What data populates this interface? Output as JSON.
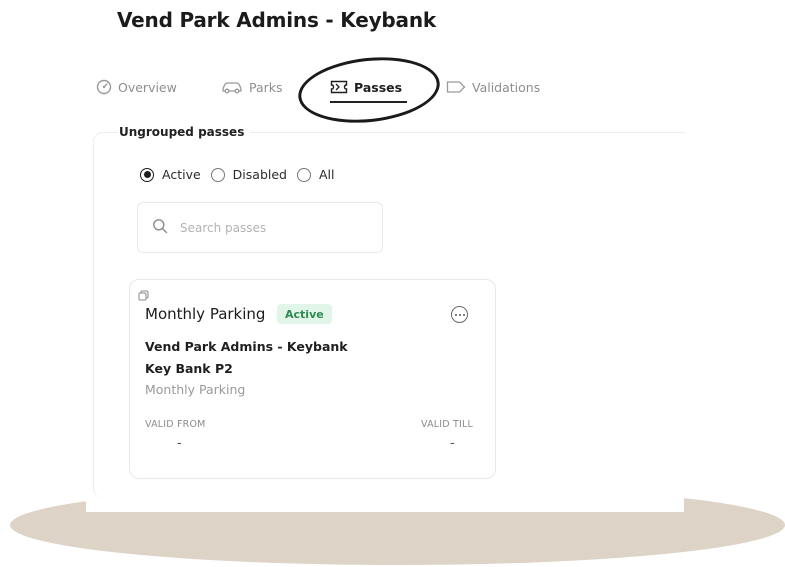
{
  "page": {
    "title": "Vend Park Admins - Keybank"
  },
  "tabs": [
    {
      "label": "Overview",
      "icon": "gauge-icon",
      "active": false
    },
    {
      "label": "Parks",
      "icon": "car-icon",
      "active": false
    },
    {
      "label": "Passes",
      "icon": "ticket-icon",
      "active": true
    },
    {
      "label": "Validations",
      "icon": "tag-icon",
      "active": false
    }
  ],
  "group": {
    "label": "Ungrouped passes"
  },
  "filters": {
    "options": [
      "Active",
      "Disabled",
      "All"
    ],
    "selected": "Active"
  },
  "search": {
    "placeholder": "Search passes",
    "value": ""
  },
  "pass_card": {
    "name": "Monthly Parking",
    "status": "Active",
    "operator": "Vend Park Admins - Keybank",
    "location": "Key Bank P2",
    "type": "Monthly Parking",
    "valid_from_label": "VALID FROM",
    "valid_from": "-",
    "valid_till_label": "VALID TILL",
    "valid_till": "-"
  },
  "colors": {
    "badge_bg": "#e2f5e9",
    "badge_text": "#2f8a52",
    "backdrop": "#ddd3c6",
    "annotation": "#1a1a1a"
  }
}
